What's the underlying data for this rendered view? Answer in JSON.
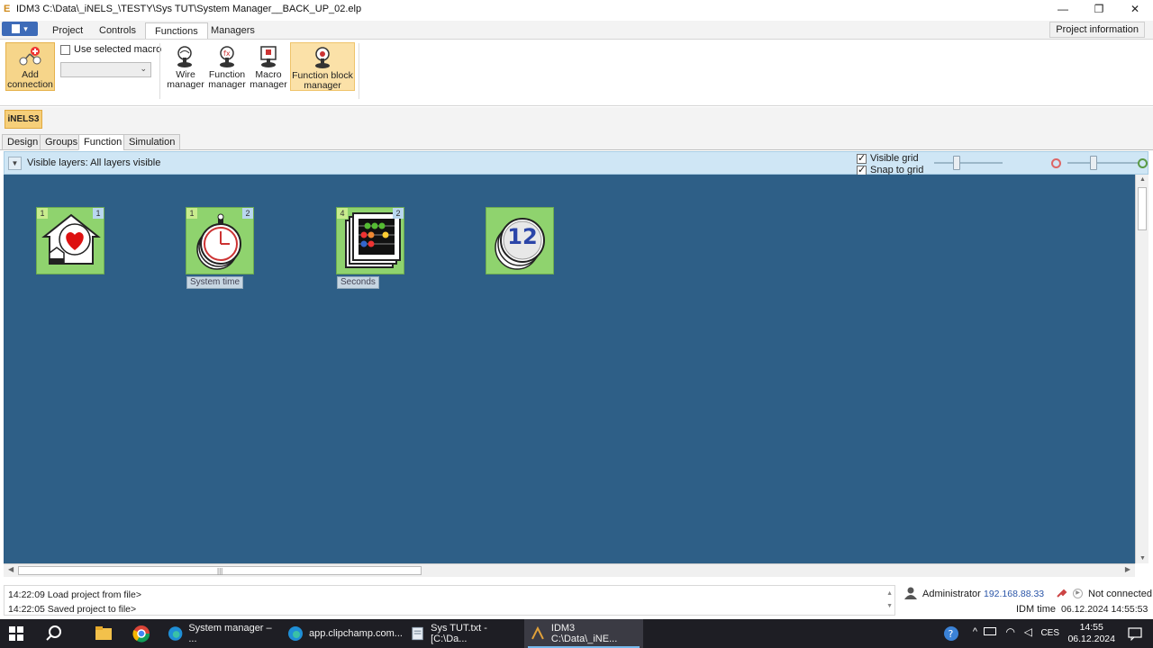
{
  "window": {
    "title": "IDM3 C:\\Data\\_iNELS_\\TESTY\\Sys TUT\\System Manager__BACK_UP_02.elp",
    "minimize": "—",
    "restore": "❐",
    "close": "✕"
  },
  "ribbon_tabs": [
    "Project",
    "Controls",
    "Functions",
    "Managers"
  ],
  "project_info_label": "Project information",
  "ribbon": {
    "add_connection": "Add connection",
    "use_selected_macro": "Use selected macro",
    "wire_manager": "Wire manager",
    "function_manager": "Function manager",
    "macro_manager": "Macro manager",
    "function_block_manager": "Function block manager"
  },
  "system_badge": "iNELS3",
  "mode_tabs": [
    "Design",
    "Groups",
    "Function",
    "Simulation"
  ],
  "layers": {
    "label": "Visible layers: All layers visible",
    "visible_grid": "Visible grid",
    "snap_to_grid": "Snap to grid"
  },
  "blocks": [
    {
      "icon": "heart-house-icon",
      "in": "1",
      "out": "1",
      "label": ""
    },
    {
      "icon": "stopwatch-icon",
      "in": "1",
      "out": "2",
      "label": "System time"
    },
    {
      "icon": "abacus-icon",
      "in": "4",
      "out": "2",
      "label": "Seconds"
    },
    {
      "icon": "counter-12-icon",
      "in": "",
      "out": "",
      "label": "",
      "number": "12"
    }
  ],
  "log": [
    "14:22:09  Load project from file>",
    "14:22:05  Saved project to file>"
  ],
  "status": {
    "user": "Administrator",
    "ip": "192.168.88.33",
    "connection": "Not connected",
    "idm_time_label": "IDM time",
    "idm_time_value": "06.12.2024 14:55:53"
  },
  "taskbar": {
    "apps": [
      {
        "label": "System manager – ...",
        "icon": "edge-icon"
      },
      {
        "label": "app.clipchamp.com...",
        "icon": "edge-icon"
      },
      {
        "label": "Sys TUT.txt - [C:\\Da...",
        "icon": "notepad-icon"
      },
      {
        "label": "IDM3 C:\\Data\\_iNE...",
        "icon": "idm3-icon"
      }
    ],
    "language": "CES",
    "time": "14:55",
    "date": "06.12.2024"
  },
  "colors": {
    "canvas": "#2e5f87",
    "block_green": "#8fd36e",
    "highlight": "#f6d58a"
  }
}
